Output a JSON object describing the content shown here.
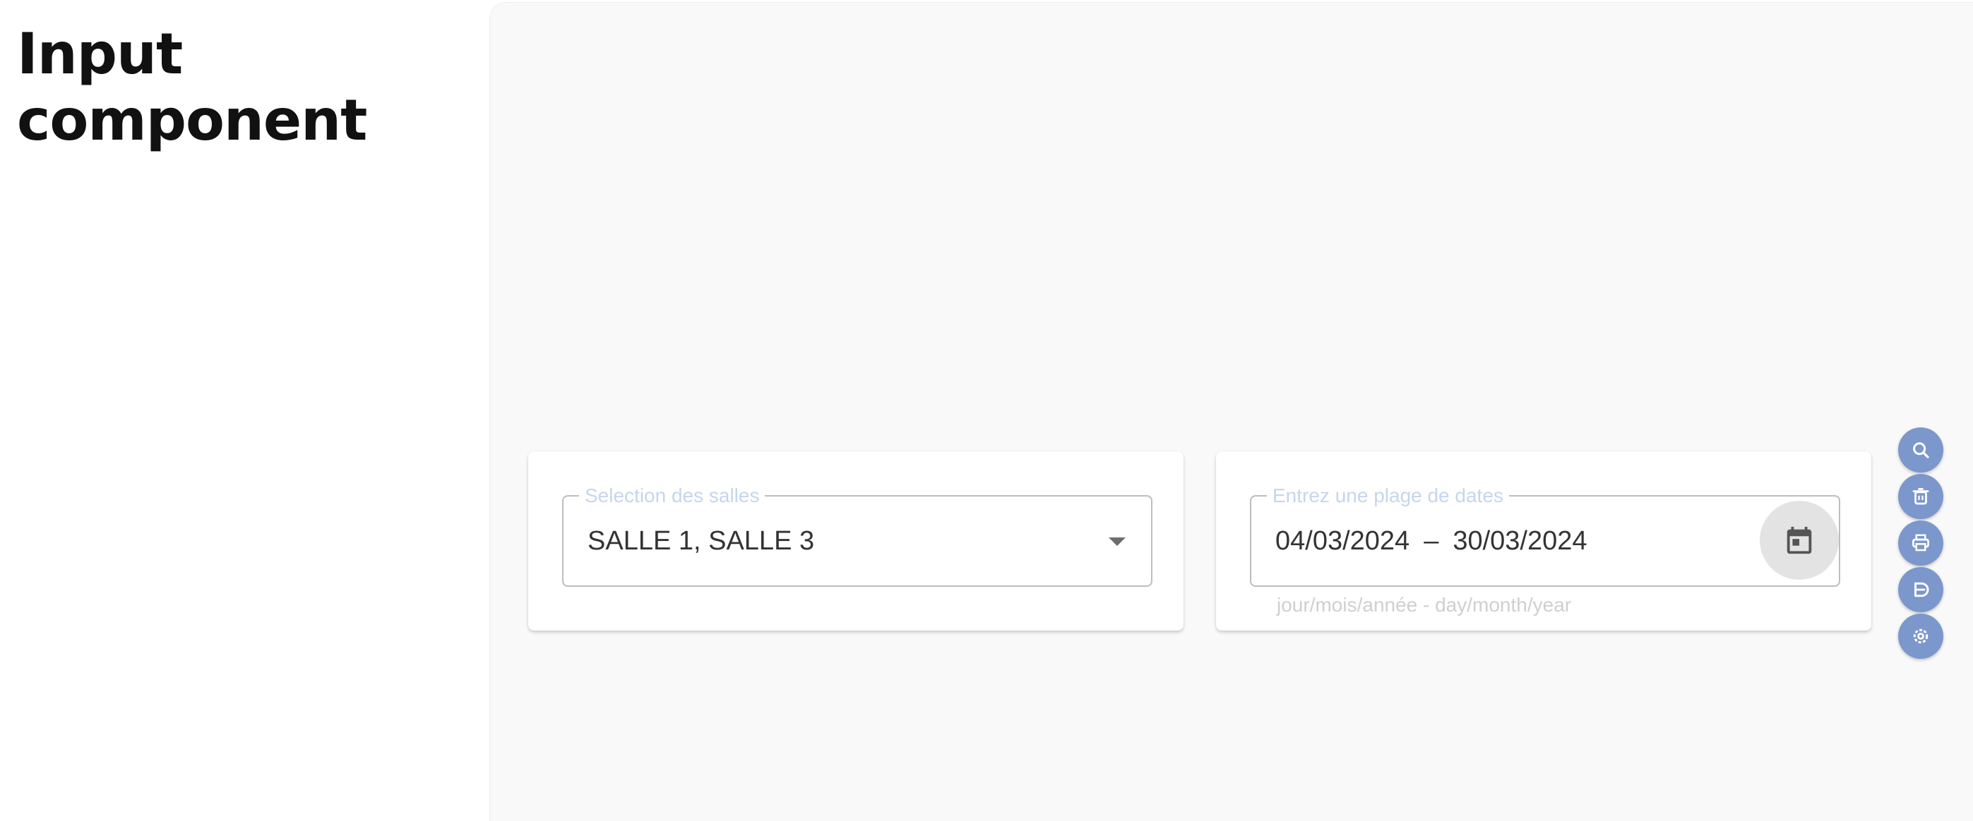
{
  "page": {
    "title_line1": "Input",
    "title_line2": "component"
  },
  "rooms_field": {
    "label": "Selection des salles",
    "value": "SALLE 1, SALLE 3",
    "icon": "arrow-drop-down-icon"
  },
  "date_field": {
    "label": "Entrez une plage de dates",
    "start": "04/03/2024",
    "separator": "–",
    "end": "30/03/2024",
    "hint": "jour/mois/année - day/month/year",
    "icon": "calendar-icon"
  },
  "side_actions": [
    {
      "icon": "search-icon"
    },
    {
      "icon": "trash-icon"
    },
    {
      "icon": "print-icon"
    },
    {
      "icon": "export-icon"
    },
    {
      "icon": "settings-icon"
    }
  ],
  "colors": {
    "fab": "#7b97cc",
    "label": "#c5d6ee",
    "preview_bg": "#f9f9f9"
  }
}
